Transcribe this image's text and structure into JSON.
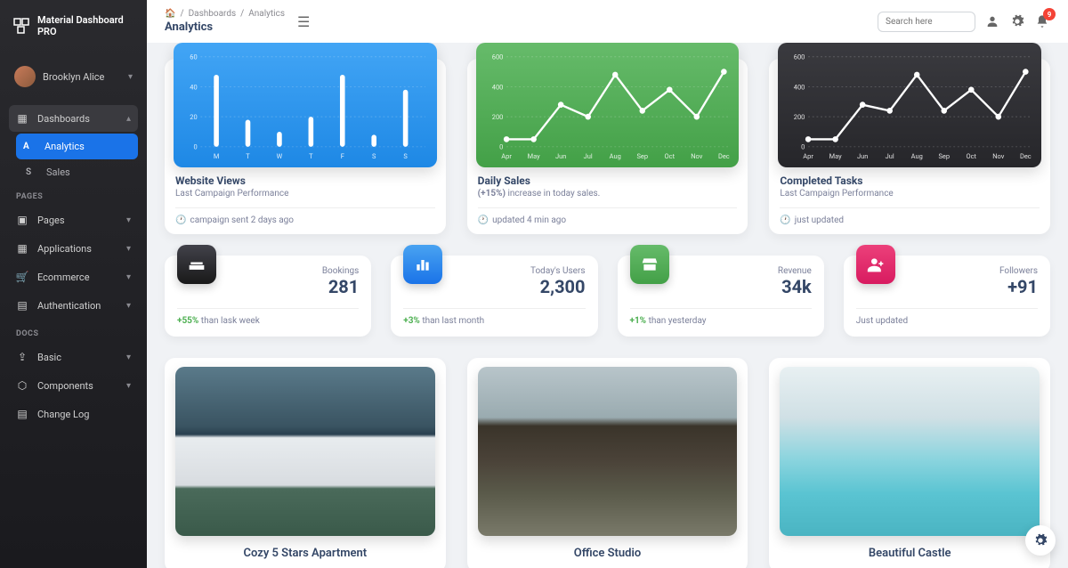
{
  "brand": "Material Dashboard PRO",
  "user": {
    "name": "Brooklyn Alice"
  },
  "sidebar": {
    "dashboards": "Dashboards",
    "analytics": "Analytics",
    "sales": "Sales",
    "pages_section": "PAGES",
    "pages": "Pages",
    "applications": "Applications",
    "ecommerce": "Ecommerce",
    "authentication": "Authentication",
    "docs_section": "DOCS",
    "basic": "Basic",
    "components": "Components",
    "changelog": "Change Log"
  },
  "breadcrumb": {
    "dashboards": "Dashboards",
    "analytics": "Analytics"
  },
  "page_title": "Analytics",
  "search_placeholder": "Search here",
  "notif_count": "9",
  "charts": [
    {
      "title": "Website Views",
      "sub": "Last Campaign Performance",
      "footer": "campaign sent 2 days ago"
    },
    {
      "title": "Daily Sales",
      "sub_prefix": "(+15%)",
      "sub_rest": " increase in today sales.",
      "footer": "updated 4 min ago"
    },
    {
      "title": "Completed Tasks",
      "sub": "Last Campaign Performance",
      "footer": "just updated"
    }
  ],
  "chart_data": [
    {
      "type": "bar",
      "categories": [
        "M",
        "T",
        "W",
        "T",
        "F",
        "S",
        "S"
      ],
      "values": [
        48,
        18,
        10,
        20,
        48,
        8,
        38
      ],
      "ylim": [
        0,
        60
      ],
      "yticks": [
        0,
        20,
        40,
        60
      ]
    },
    {
      "type": "line",
      "categories": [
        "Apr",
        "May",
        "Jun",
        "Jul",
        "Aug",
        "Sep",
        "Oct",
        "Nov",
        "Dec"
      ],
      "values": [
        50,
        50,
        280,
        200,
        480,
        240,
        380,
        200,
        500
      ],
      "ylim": [
        0,
        600
      ],
      "yticks": [
        0,
        200,
        400,
        600
      ]
    },
    {
      "type": "line",
      "categories": [
        "Apr",
        "May",
        "Jun",
        "Jul",
        "Aug",
        "Sep",
        "Oct",
        "Nov",
        "Dec"
      ],
      "values": [
        50,
        50,
        280,
        240,
        480,
        240,
        380,
        200,
        500
      ],
      "ylim": [
        0,
        600
      ],
      "yticks": [
        0,
        200,
        400,
        600
      ]
    }
  ],
  "stats": [
    {
      "label": "Bookings",
      "value": "281",
      "delta": "+55%",
      "rest": " than lask week"
    },
    {
      "label": "Today's Users",
      "value": "2,300",
      "delta": "+3%",
      "rest": " than last month"
    },
    {
      "label": "Revenue",
      "value": "34k",
      "delta": "+1%",
      "rest": " than yesterday"
    },
    {
      "label": "Followers",
      "value": "+91",
      "plain": "Just updated"
    }
  ],
  "properties": [
    {
      "title": "Cozy 5 Stars Apartment"
    },
    {
      "title": "Office Studio"
    },
    {
      "title": "Beautiful Castle"
    }
  ]
}
